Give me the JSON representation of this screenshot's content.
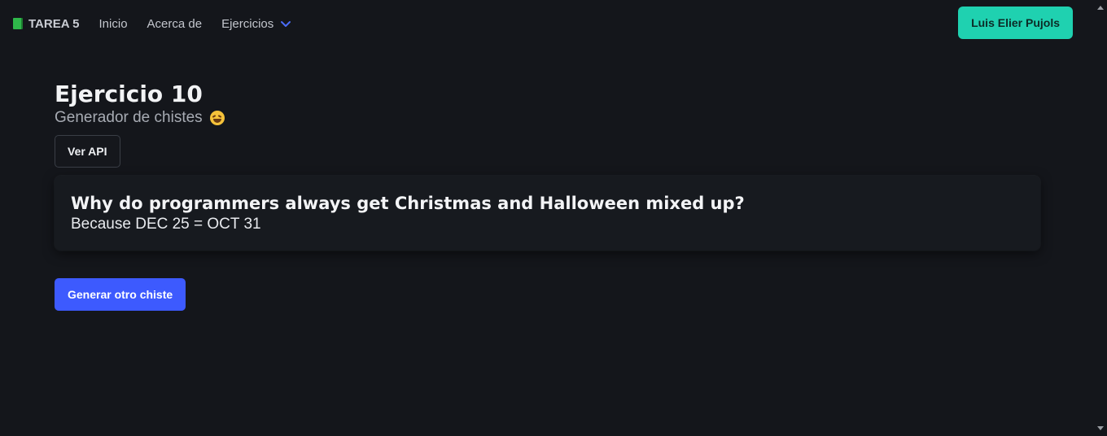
{
  "navbar": {
    "brand": "TAREA 5",
    "links": [
      "Inicio",
      "Acerca de"
    ],
    "dropdown": "Ejercicios",
    "user_button": "Luis Elier Pujols",
    "icons": {
      "brand": "book-icon",
      "dropdown": "chevron-down-icon"
    }
  },
  "main": {
    "title": "Ejercicio 10",
    "subtitle": "Generador de chistes",
    "subtitle_icon": "rofl-emoji-icon",
    "api_button": "Ver API",
    "joke": {
      "setup": "Why do programmers always get Christmas and Halloween mixed up?",
      "punchline": "Because DEC 25 = OCT 31"
    },
    "generate_button": "Generar otro chiste"
  },
  "colors": {
    "background": "#14161b",
    "user_button": "#1fd1b0",
    "primary": "#3d5afe",
    "chevron": "#4a6cf7"
  }
}
